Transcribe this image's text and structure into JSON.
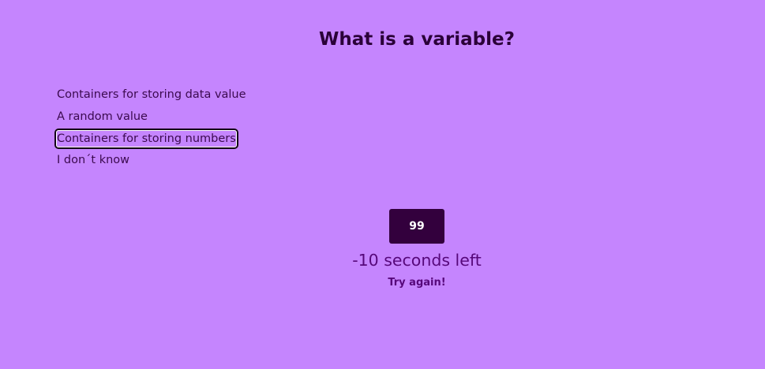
{
  "question": {
    "title": "What is a variable?"
  },
  "answers": [
    {
      "label": "Containers for storing data value"
    },
    {
      "label": "A random value"
    },
    {
      "label": "Containers for storing numbers",
      "focused": true
    },
    {
      "label": "I don´t know"
    }
  ],
  "score": {
    "value": "99"
  },
  "timer": {
    "text": "-10 seconds left"
  },
  "status": {
    "message": "Try again!"
  },
  "colors": {
    "background": "#c585fe",
    "title": "#2a0038",
    "score_box": "#33003d",
    "timer_text": "#56087a"
  }
}
